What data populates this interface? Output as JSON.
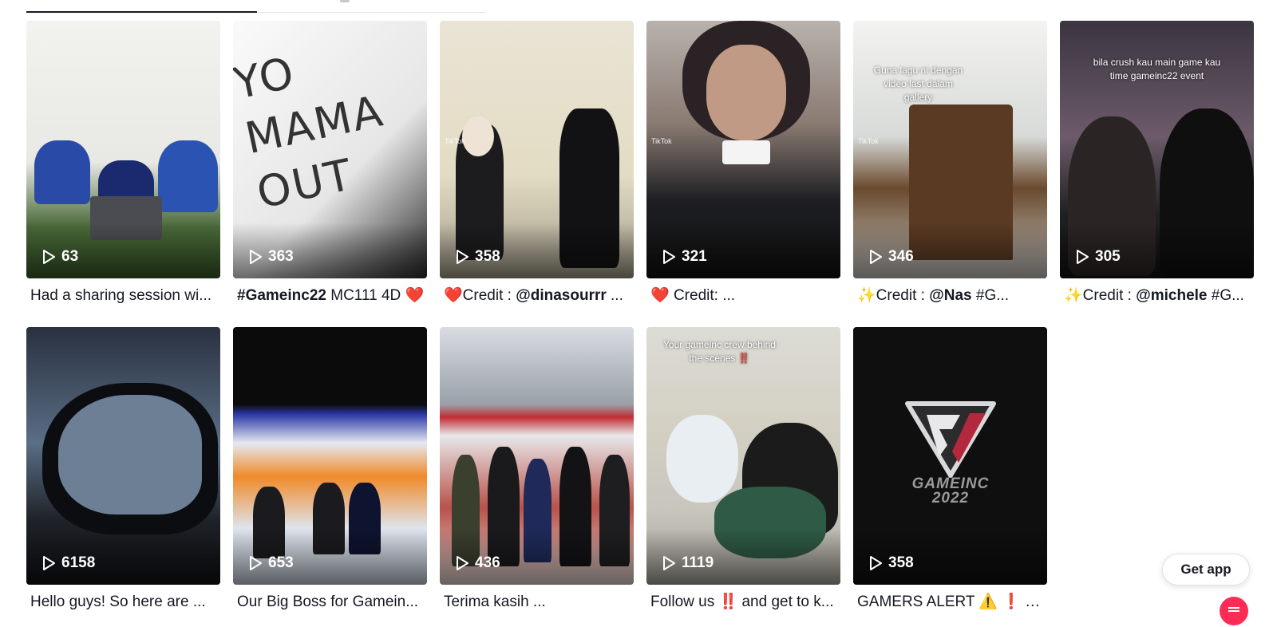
{
  "tabs": {
    "active_index": 0
  },
  "videos": [
    {
      "views": "63",
      "caption_prefix": "",
      "caption_bold": "",
      "caption_rest": "Had a sharing session wi...",
      "overlay_text": "",
      "watermark": ""
    },
    {
      "views": "363",
      "caption_prefix": "",
      "caption_bold": "#Gameinc22",
      "caption_rest": " MC111 4D ❤️",
      "overlay_text": "",
      "watermark": "",
      "paper_text": "YO MAMA OUT"
    },
    {
      "views": "358",
      "caption_prefix": "❤️",
      "caption_bold": "",
      "caption_rest": "Credit : ",
      "caption_bold2": "@dinasourrr",
      "caption_rest2": " ...",
      "overlay_text": "",
      "watermark": "TikTok"
    },
    {
      "views": "321",
      "caption_prefix": "❤️",
      "caption_bold": "",
      "caption_rest": "  Credit: ...",
      "overlay_text": "",
      "watermark": "TikTok"
    },
    {
      "views": "346",
      "caption_prefix": "✨",
      "caption_bold": "",
      "caption_rest": "Credit : ",
      "caption_bold2": "@Nas",
      "caption_rest2": " #G...",
      "overlay_text": "Guna lagu ni dengan video last dalam gallery",
      "watermark": "TikTok"
    },
    {
      "views": "305",
      "caption_prefix": "✨",
      "caption_bold": "",
      "caption_rest": "Credit : ",
      "caption_bold2": "@michele",
      "caption_rest2": " #G...",
      "overlay_text": "bila crush kau main game kau time gameinc22 event",
      "watermark": ""
    },
    {
      "views": "6158",
      "caption_prefix": "",
      "caption_bold": "",
      "caption_rest": "Hello guys! So here are ...",
      "overlay_text": "",
      "watermark": ""
    },
    {
      "views": "653",
      "caption_prefix": "",
      "caption_bold": "",
      "caption_rest": "Our Big Boss for Gamein...",
      "overlay_text": "",
      "watermark": ""
    },
    {
      "views": "436",
      "caption_prefix": "",
      "caption_bold": "",
      "caption_rest": "Terima kasih ...",
      "overlay_text": "",
      "watermark": ""
    },
    {
      "views": "1119",
      "caption_prefix": "",
      "caption_bold": "",
      "caption_rest": "Follow us ‼️ and get to k...",
      "overlay_text": "Your gameinc crew behind the scenes ‼️",
      "watermark": ""
    },
    {
      "views": "358",
      "caption_prefix": "",
      "caption_bold": "",
      "caption_rest": "GAMERS ALERT ⚠️ ❗ #...",
      "overlay_text": "",
      "watermark": "",
      "logo_text": "GAMEINC 2022"
    }
  ],
  "get_app_label": "Get app",
  "colors": {
    "accent": "#fe2c55",
    "text": "#161823",
    "heart": "#e31b23"
  }
}
